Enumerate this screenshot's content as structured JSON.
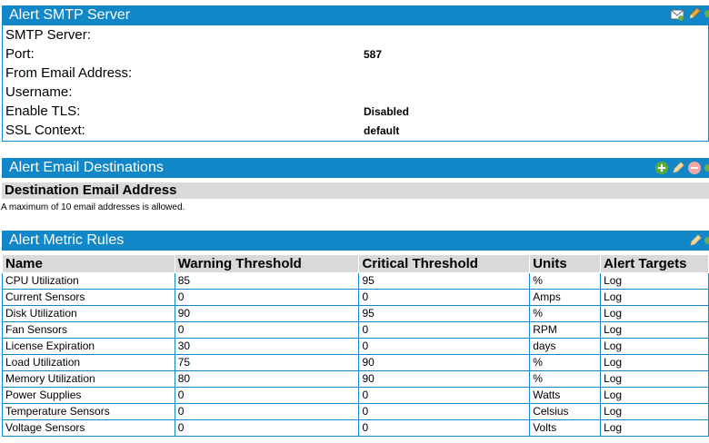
{
  "smtp": {
    "title": "Alert SMTP Server",
    "fields": [
      {
        "label": "SMTP Server:",
        "value": ""
      },
      {
        "label": "Port:",
        "value": "587"
      },
      {
        "label": "From Email Address:",
        "value": ""
      },
      {
        "label": "Username:",
        "value": ""
      },
      {
        "label": "Enable TLS:",
        "value": "Disabled"
      },
      {
        "label": "SSL Context:",
        "value": "default"
      }
    ],
    "icons": [
      "email-icon",
      "edit-pencil-icon"
    ]
  },
  "destinations": {
    "title": "Alert Email Destinations",
    "column_header": "Destination Email Address",
    "note": "A maximum of 10 email addresses is allowed.",
    "icons": [
      "add-icon",
      "edit-pencil-icon",
      "remove-icon"
    ]
  },
  "rules": {
    "title": "Alert Metric Rules",
    "columns": [
      "Name",
      "Warning Threshold",
      "Critical Threshold",
      "Units",
      "Alert Targets"
    ],
    "rows": [
      {
        "name": "CPU Utilization",
        "warning": "85",
        "critical": "95",
        "units": "%",
        "targets": "Log"
      },
      {
        "name": "Current Sensors",
        "warning": "0",
        "critical": "0",
        "units": "Amps",
        "targets": "Log"
      },
      {
        "name": "Disk Utilization",
        "warning": "90",
        "critical": "95",
        "units": "%",
        "targets": "Log"
      },
      {
        "name": "Fan Sensors",
        "warning": "0",
        "critical": "0",
        "units": "RPM",
        "targets": "Log"
      },
      {
        "name": "License Expiration",
        "warning": "30",
        "critical": "0",
        "units": "days",
        "targets": "Log"
      },
      {
        "name": "Load Utilization",
        "warning": "75",
        "critical": "90",
        "units": "%",
        "targets": "Log"
      },
      {
        "name": "Memory Utilization",
        "warning": "80",
        "critical": "90",
        "units": "%",
        "targets": "Log"
      },
      {
        "name": "Power Supplies",
        "warning": "0",
        "critical": "0",
        "units": "Watts",
        "targets": "Log"
      },
      {
        "name": "Temperature Sensors",
        "warning": "0",
        "critical": "0",
        "units": "Celsius",
        "targets": "Log"
      },
      {
        "name": "Voltage Sensors",
        "warning": "0",
        "critical": "0",
        "units": "Volts",
        "targets": "Log"
      }
    ],
    "icons": [
      "edit-pencil-icon"
    ]
  }
}
